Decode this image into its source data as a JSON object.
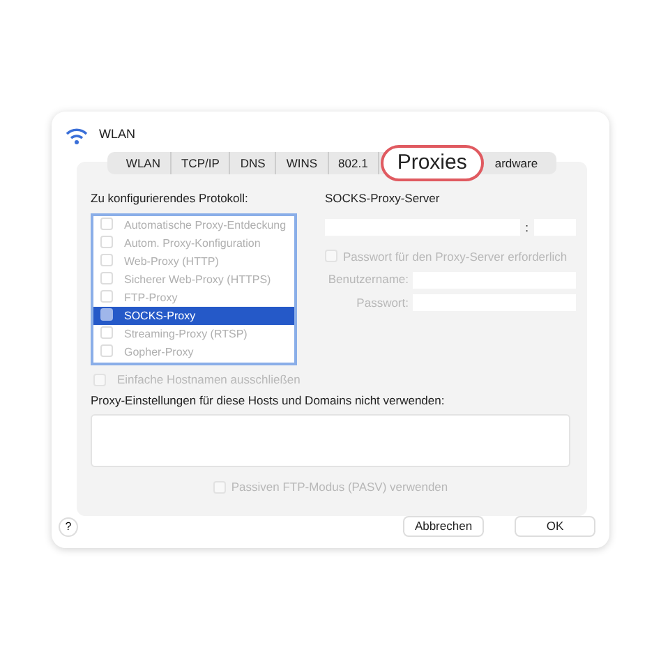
{
  "window": {
    "title": "WLAN"
  },
  "tabs": [
    {
      "label": "WLAN",
      "selected": false
    },
    {
      "label": "TCP/IP",
      "selected": false
    },
    {
      "label": "DNS",
      "selected": false
    },
    {
      "label": "WINS",
      "selected": false
    },
    {
      "label": "802.1",
      "selected": false
    },
    {
      "label": "Proxies",
      "selected": true
    },
    {
      "label": "ardware",
      "selected": false
    }
  ],
  "protocols": {
    "label": "Zu konfigurierendes Protokoll:",
    "items": [
      {
        "label": "Automatische Proxy-Entdeckung",
        "checked": false,
        "selected": false
      },
      {
        "label": "Autom. Proxy-Konfiguration",
        "checked": false,
        "selected": false
      },
      {
        "label": "Web-Proxy (HTTP)",
        "checked": false,
        "selected": false
      },
      {
        "label": "Sicherer Web-Proxy (HTTPS)",
        "checked": false,
        "selected": false
      },
      {
        "label": "FTP-Proxy",
        "checked": false,
        "selected": false
      },
      {
        "label": "SOCKS-Proxy",
        "checked": false,
        "selected": true
      },
      {
        "label": "Streaming-Proxy (RTSP)",
        "checked": false,
        "selected": false
      },
      {
        "label": "Gopher-Proxy",
        "checked": false,
        "selected": false
      }
    ]
  },
  "exclude_simple_hostnames": {
    "label": "Einfache Hostnamen ausschließen",
    "checked": false,
    "disabled": true
  },
  "server": {
    "label": "SOCKS-Proxy-Server",
    "separator": ":",
    "password_required": {
      "label": "Passwort für den Proxy-Server erforderlich",
      "checked": false,
      "disabled": true
    },
    "username_label": "Benutzername:",
    "password_label": "Passwort:"
  },
  "bypass": {
    "label": "Proxy-Einstellungen für diese Hosts und Domains nicht verwenden:"
  },
  "passive_ftp": {
    "label": "Passiven FTP-Modus (PASV) verwenden",
    "checked": false,
    "disabled": true
  },
  "help": "?",
  "buttons": [
    {
      "label": "Abbrechen"
    },
    {
      "label": "OK"
    }
  ]
}
